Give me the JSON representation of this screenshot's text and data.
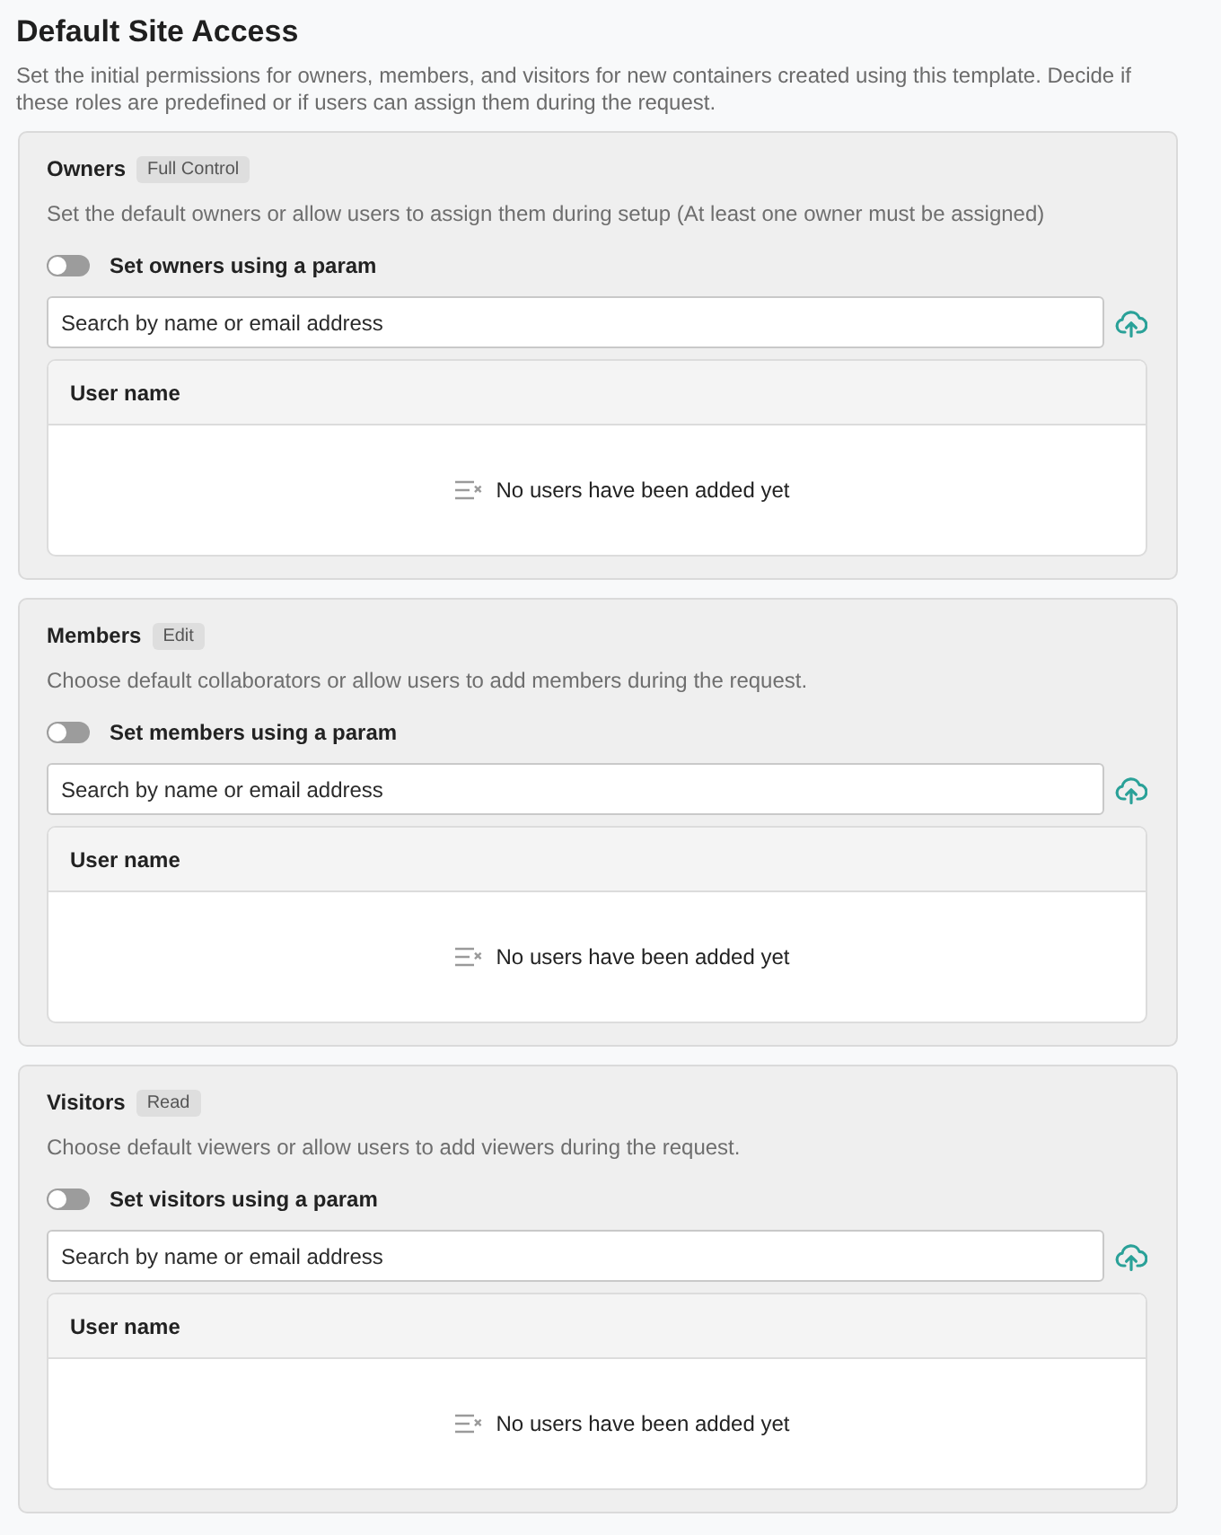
{
  "title": "Default Site Access",
  "description": "Set the initial permissions for owners, members, and visitors for new containers created using this template. Decide if these roles are predefined or if users can assign them during the request.",
  "sections": [
    {
      "name": "Owners",
      "badge": "Full Control",
      "description": "Set the default owners or allow users to assign them during setup (At least one owner must be assigned)",
      "toggle": {
        "label": "Set owners using a param",
        "on": false
      },
      "search": {
        "placeholder": "Search by name or email address"
      },
      "table": {
        "columns": [
          "User name"
        ],
        "empty_message": "No users have been added yet"
      }
    },
    {
      "name": "Members",
      "badge": "Edit",
      "description": "Choose default collaborators or allow users to add members during the request.",
      "toggle": {
        "label": "Set members using a param",
        "on": false
      },
      "search": {
        "placeholder": "Search by name or email address"
      },
      "table": {
        "columns": [
          "User name"
        ],
        "empty_message": "No users have been added yet"
      }
    },
    {
      "name": "Visitors",
      "badge": "Read",
      "description": "Choose default viewers or allow users to add viewers during the request.",
      "toggle": {
        "label": "Set visitors using a param",
        "on": false
      },
      "search": {
        "placeholder": "Search by name or email address"
      },
      "table": {
        "columns": [
          "User name"
        ],
        "empty_message": "No users have been added yet"
      }
    }
  ]
}
